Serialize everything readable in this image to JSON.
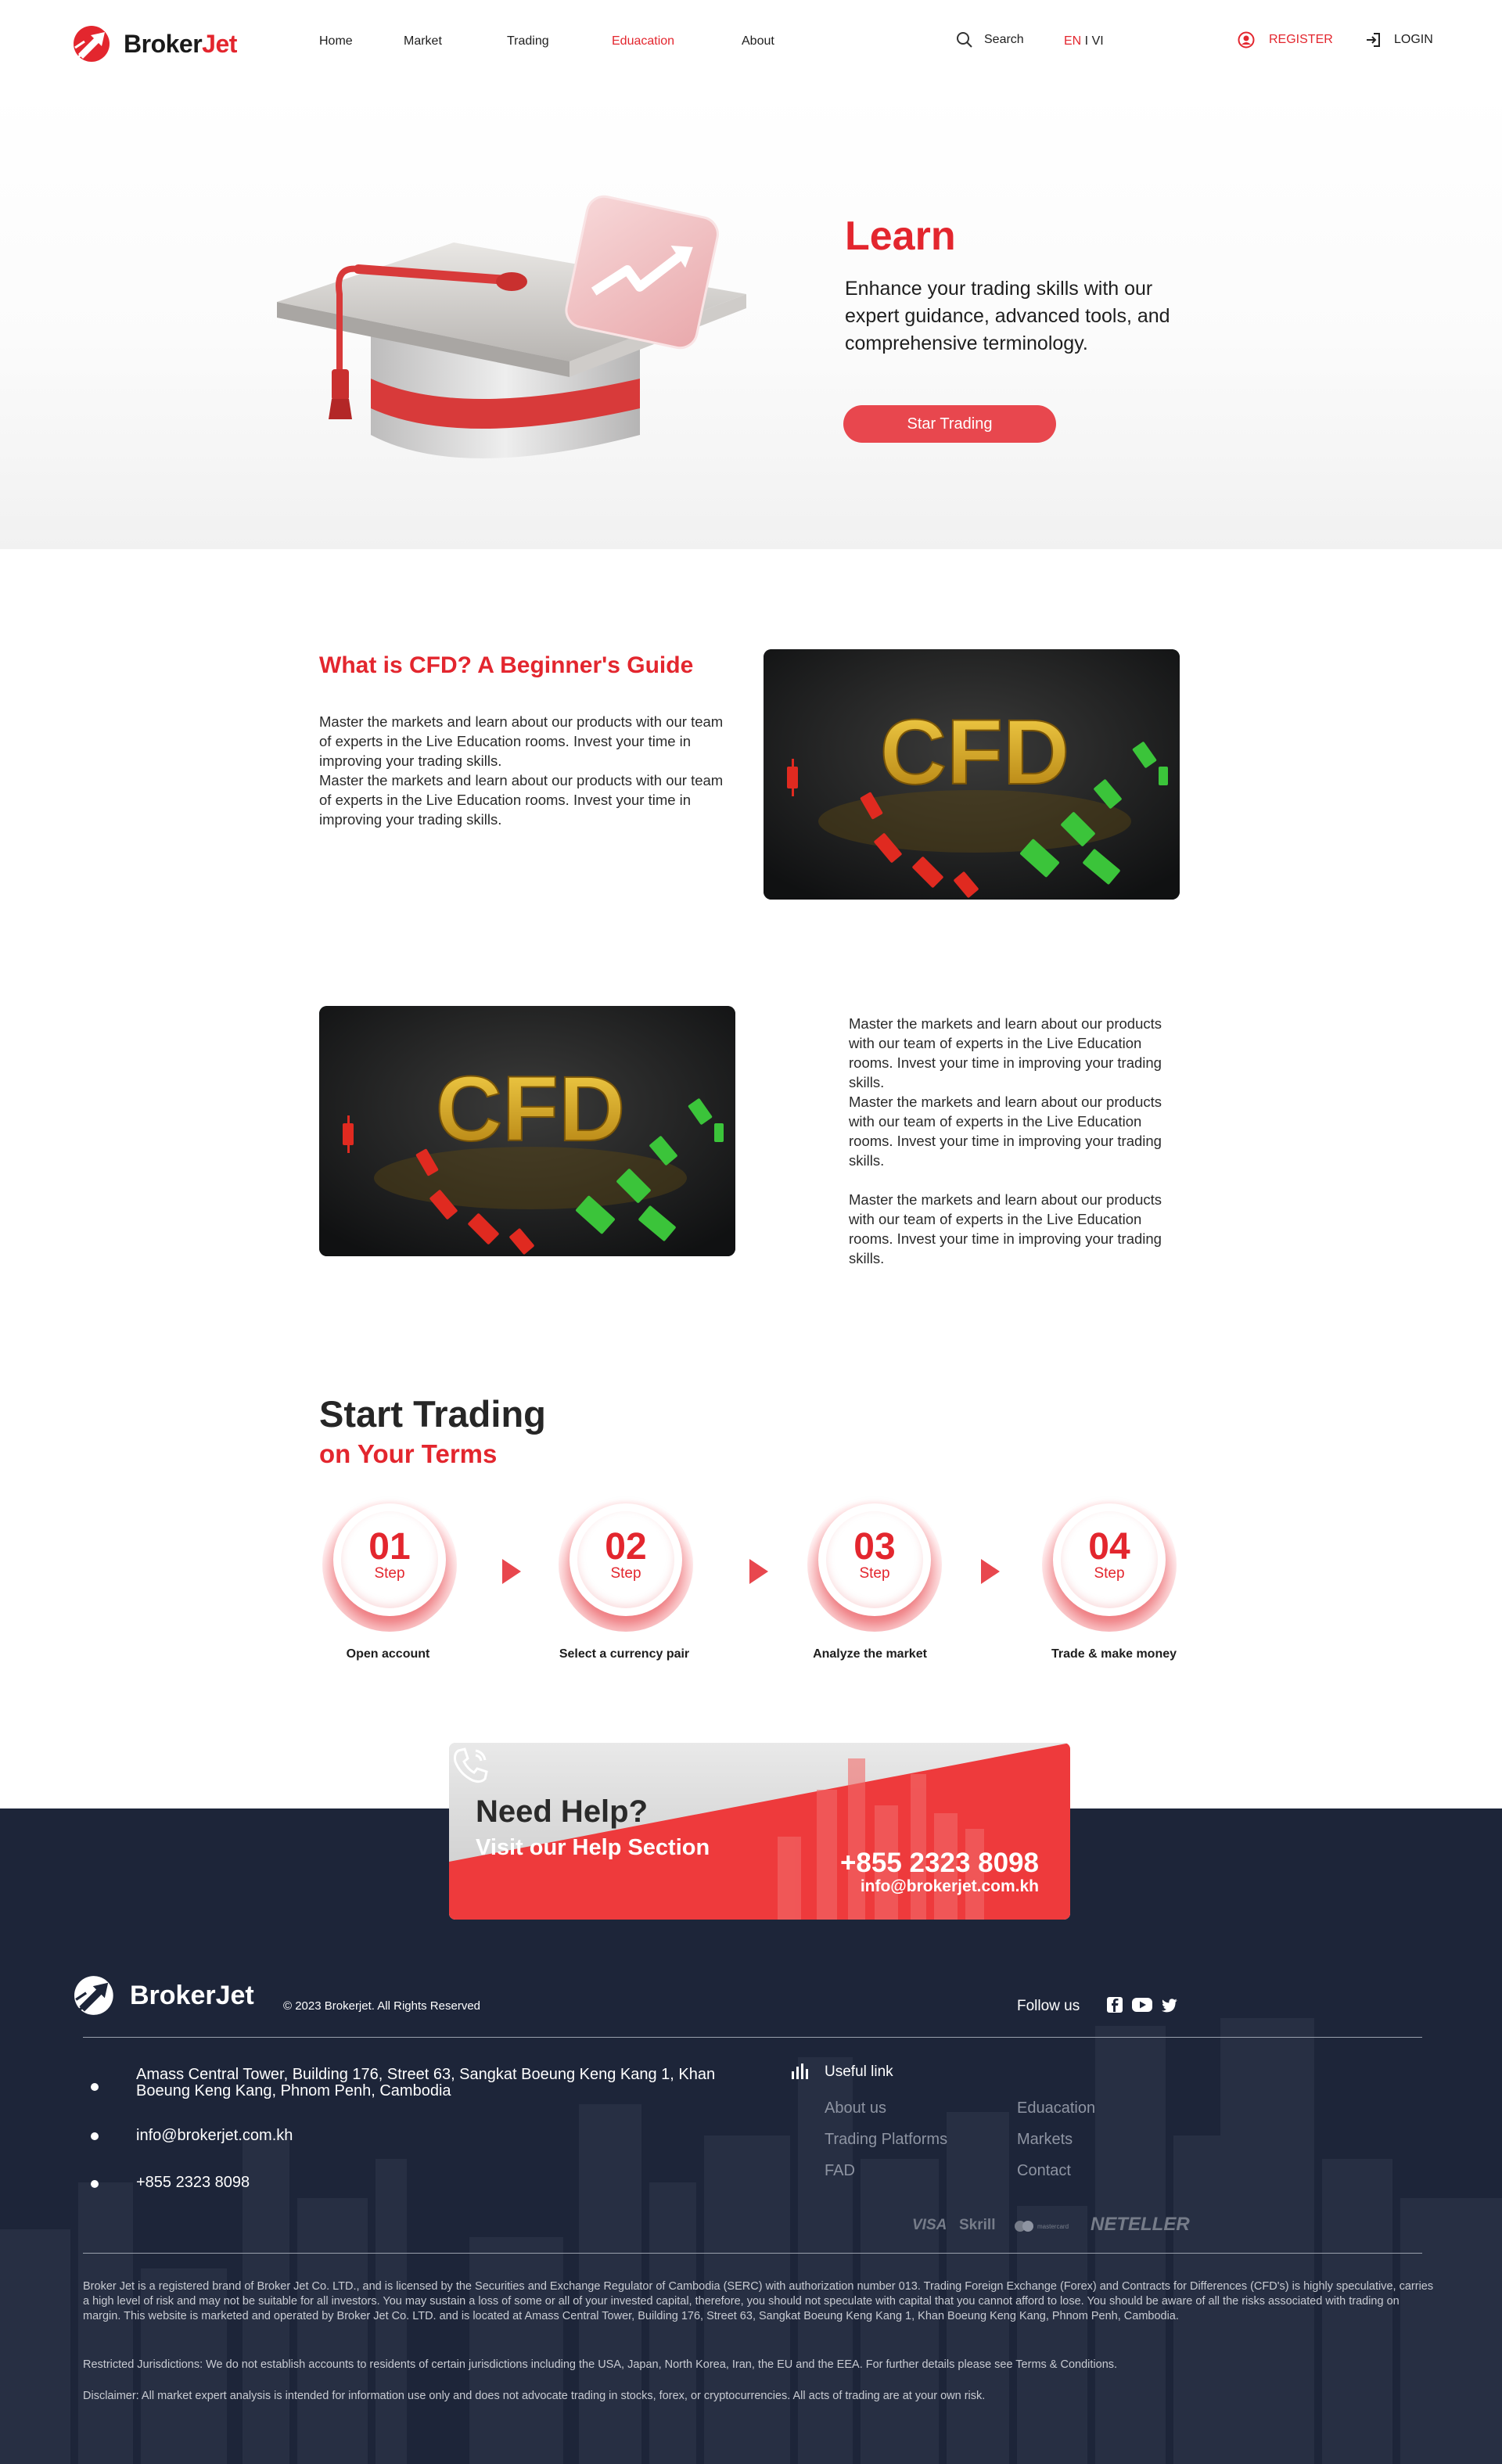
{
  "brand": {
    "name_part1": "Broker",
    "name_part2": "Jet",
    "accent": "#e3262e",
    "footer_name": "BrokerJet"
  },
  "nav": {
    "items": [
      {
        "label": "Home"
      },
      {
        "label": "Market"
      },
      {
        "label": "Trading"
      },
      {
        "label": "Eduacation",
        "active": true
      },
      {
        "label": "About"
      }
    ],
    "search_label": "Search",
    "lang_selected": "EN",
    "lang_sep": " I ",
    "lang_other": "VI",
    "register_label": "REGISTER",
    "login_label": "LOGIN"
  },
  "hero": {
    "title": "Learn",
    "subtitle": "Enhance your trading skills with our expert guidance, advanced tools, and comprehensive terminology.",
    "button_label": "Star Trading"
  },
  "cfd_section": {
    "title": "What is CFD? A Beginner's Guide",
    "paragraphs": [
      "Master the markets and learn about our products with our team of experts in the Live Education rooms. Invest your time in improving your trading skills.",
      "Master the markets and learn about our products with our team of experts in the Live Education rooms. Invest your time in improving your trading skills."
    ],
    "image_text": "CFD"
  },
  "cfd_section_2": {
    "paragraphs": [
      "Master the markets and learn about our products with our team of experts in the Live Education rooms. Invest your time in improving your trading skills.",
      "Master the markets and learn about our products with our team of experts in the Live Education rooms. Invest your time in improving your trading skills.",
      "Master the markets and learn about our products with our team of experts in the Live Education rooms. Invest your time in improving your trading skills."
    ],
    "image_text": "CFD"
  },
  "start_trading": {
    "title": "Start Trading",
    "subtitle": "on Your Terms",
    "steps": [
      {
        "number": "01",
        "word": "Step",
        "label": "Open account"
      },
      {
        "number": "02",
        "word": "Step",
        "label": "Select a currency pair"
      },
      {
        "number": "03",
        "word": "Step",
        "label": "Analyze the market"
      },
      {
        "number": "04",
        "word": "Step",
        "label": "Trade & make money"
      }
    ]
  },
  "help": {
    "title": "Need Help?",
    "subtitle": "Visit our Help Section",
    "phone": "+855 2323 8098",
    "email": "info@brokerjet.com.kh"
  },
  "footer": {
    "copyright": "© 2023 Brokerjet. All Rights Reserved",
    "follow_label": "Follow us",
    "social": [
      "facebook-icon",
      "youtube-icon",
      "twitter-icon"
    ],
    "address": "Amass Central Tower, Building 176, Street 63, Sangkat Boeung Keng Kang 1, Khan Boeung Keng Kang, Phnom Penh, Cambodia",
    "email": "info@brokerjet.com.kh",
    "phone": "+855 2323 8098",
    "useful_title": "Useful link",
    "links_col1": [
      "About us",
      "Trading Platforms",
      "FAD"
    ],
    "links_col2": [
      "Eduacation",
      "Markets",
      "Contact"
    ],
    "payments": [
      "VISA",
      "Skrill",
      "mastercard",
      "NETELLER"
    ],
    "legal": [
      "Broker Jet is a registered brand of Broker Jet Co. LTD., and is licensed by the Securities and Exchange Regulator of Cambodia (SERC) with authorization number 013. Trading Foreign Exchange (Forex) and Contracts for Differences (CFD's) is highly speculative, carries a high level of risk and may not be suitable for all investors. You may sustain a loss of some or all of your invested capital, therefore, you should not speculate with capital that you cannot afford to lose. You should be aware of all the risks associated with trading on margin. This website is marketed and operated by Broker Jet Co. LTD. and is located at Amass Central Tower, Building 176, Street 63, Sangkat Boeung Keng Kang 1, Khan Boeung Keng Kang, Phnom Penh, Cambodia.",
      "Restricted Jurisdictions: We do not establish accounts to residents of certain jurisdictions including the USA, Japan, North Korea, Iran, the EU and the EEA. For further details please see Terms & Conditions.",
      "Disclaimer: All market expert analysis is intended for information use only and does not advocate trading in stocks, forex, or cryptocurrencies. All acts of trading are at your own risk."
    ]
  }
}
